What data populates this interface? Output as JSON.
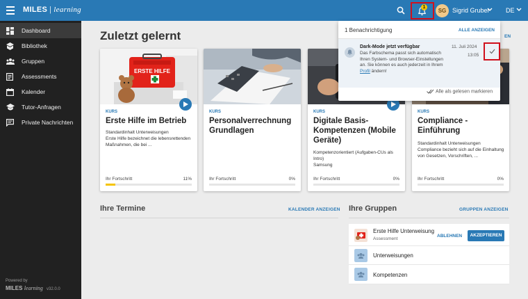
{
  "topbar": {
    "brand": "MILES",
    "brand_sub": "learning",
    "notification_count": "1",
    "avatar_initials": "SG",
    "user_name": "Sigrid Gruber",
    "language": "DE",
    "accent": "#2979b5"
  },
  "sidebar": {
    "items": [
      {
        "label": "Dashboard",
        "icon": "dashboard-icon",
        "active": true
      },
      {
        "label": "Bibliothek",
        "icon": "library-icon"
      },
      {
        "label": "Gruppen",
        "icon": "groups-icon"
      },
      {
        "label": "Assessments",
        "icon": "assessment-icon"
      },
      {
        "label": "Kalender",
        "icon": "calendar-icon"
      },
      {
        "label": "Tutor-Anfragen",
        "icon": "school-icon"
      },
      {
        "label": "Private Nachrichten",
        "icon": "chat-icon"
      }
    ],
    "powered_by": "Powered by",
    "footer_brand": "MILES",
    "footer_brand_sub": "learning",
    "version": "v32.0.0"
  },
  "main": {
    "title": "Zuletzt gelernt",
    "peek_link": "EN",
    "cards": [
      {
        "type": "KURS",
        "title": "Erste Hilfe im Betrieb",
        "description": "Standardinhalt Unterweisungen\nErste Hilfe bezeichnet die lebensrettenden Maßnahmen, die bei ...",
        "progress_label": "Ihr Fortschritt",
        "progress_value": "11%",
        "progress": 0.11,
        "image": "first-aid-kit-teddy-image"
      },
      {
        "type": "KURS",
        "title": "Personalverrechnung Grundlagen",
        "description": "",
        "progress_label": "Ihr Fortschritt",
        "progress_value": "0%",
        "progress": 0,
        "image": "calculator-desk-image"
      },
      {
        "type": "KURS",
        "title": "Digitale Basis-Kompetenzen (Mobile Geräte)",
        "description": "Kompetenzorientiert (Aufgaben-CUs als Intro)\nSamsung",
        "progress_label": "Ihr Fortschritt",
        "progress_value": "0%",
        "progress": 0,
        "image": "tablet-hands-image"
      },
      {
        "type": "KURS",
        "title": "Compliance - Einführung",
        "description": "Standardinhalt Unterweisungen\nCompliance bezieht sich auf die Einhaltung von Gesetzen, Vorschriften, ...",
        "progress_label": "Ihr Fortschritt",
        "progress_value": "0%",
        "progress": 0,
        "image": "business-meeting-image"
      }
    ],
    "termine": {
      "title": "Ihre Termine",
      "link": "KALENDER ANZEIGEN"
    },
    "gruppen": {
      "title": "Ihre Gruppen",
      "link": "GRUPPEN ANZEIGEN",
      "items": [
        {
          "name": "Erste Hilfe Unterweisung",
          "sub": "Assessment",
          "decline": "ABLEHNEN",
          "accept": "AKZEPTIEREN"
        },
        {
          "name": "Unterweisungen"
        },
        {
          "name": "Kompetenzen"
        }
      ]
    }
  },
  "notifications": {
    "count_text": "1 Benachrichtigung",
    "show_all": "ALLE ANZEIGEN",
    "item": {
      "title": "Dark-Mode jetzt verfügbar",
      "body_before": "Das Farbschema passt sich automatisch Ihren System- und Browser-Einstellungen an. Sie können es auch jederzeit in Ihrem ",
      "body_link": "Profil",
      "body_after": " ändern!",
      "date": "11. Juli 2024",
      "time": "13:05"
    },
    "mark_all": "Alle als gelesen markieren"
  }
}
